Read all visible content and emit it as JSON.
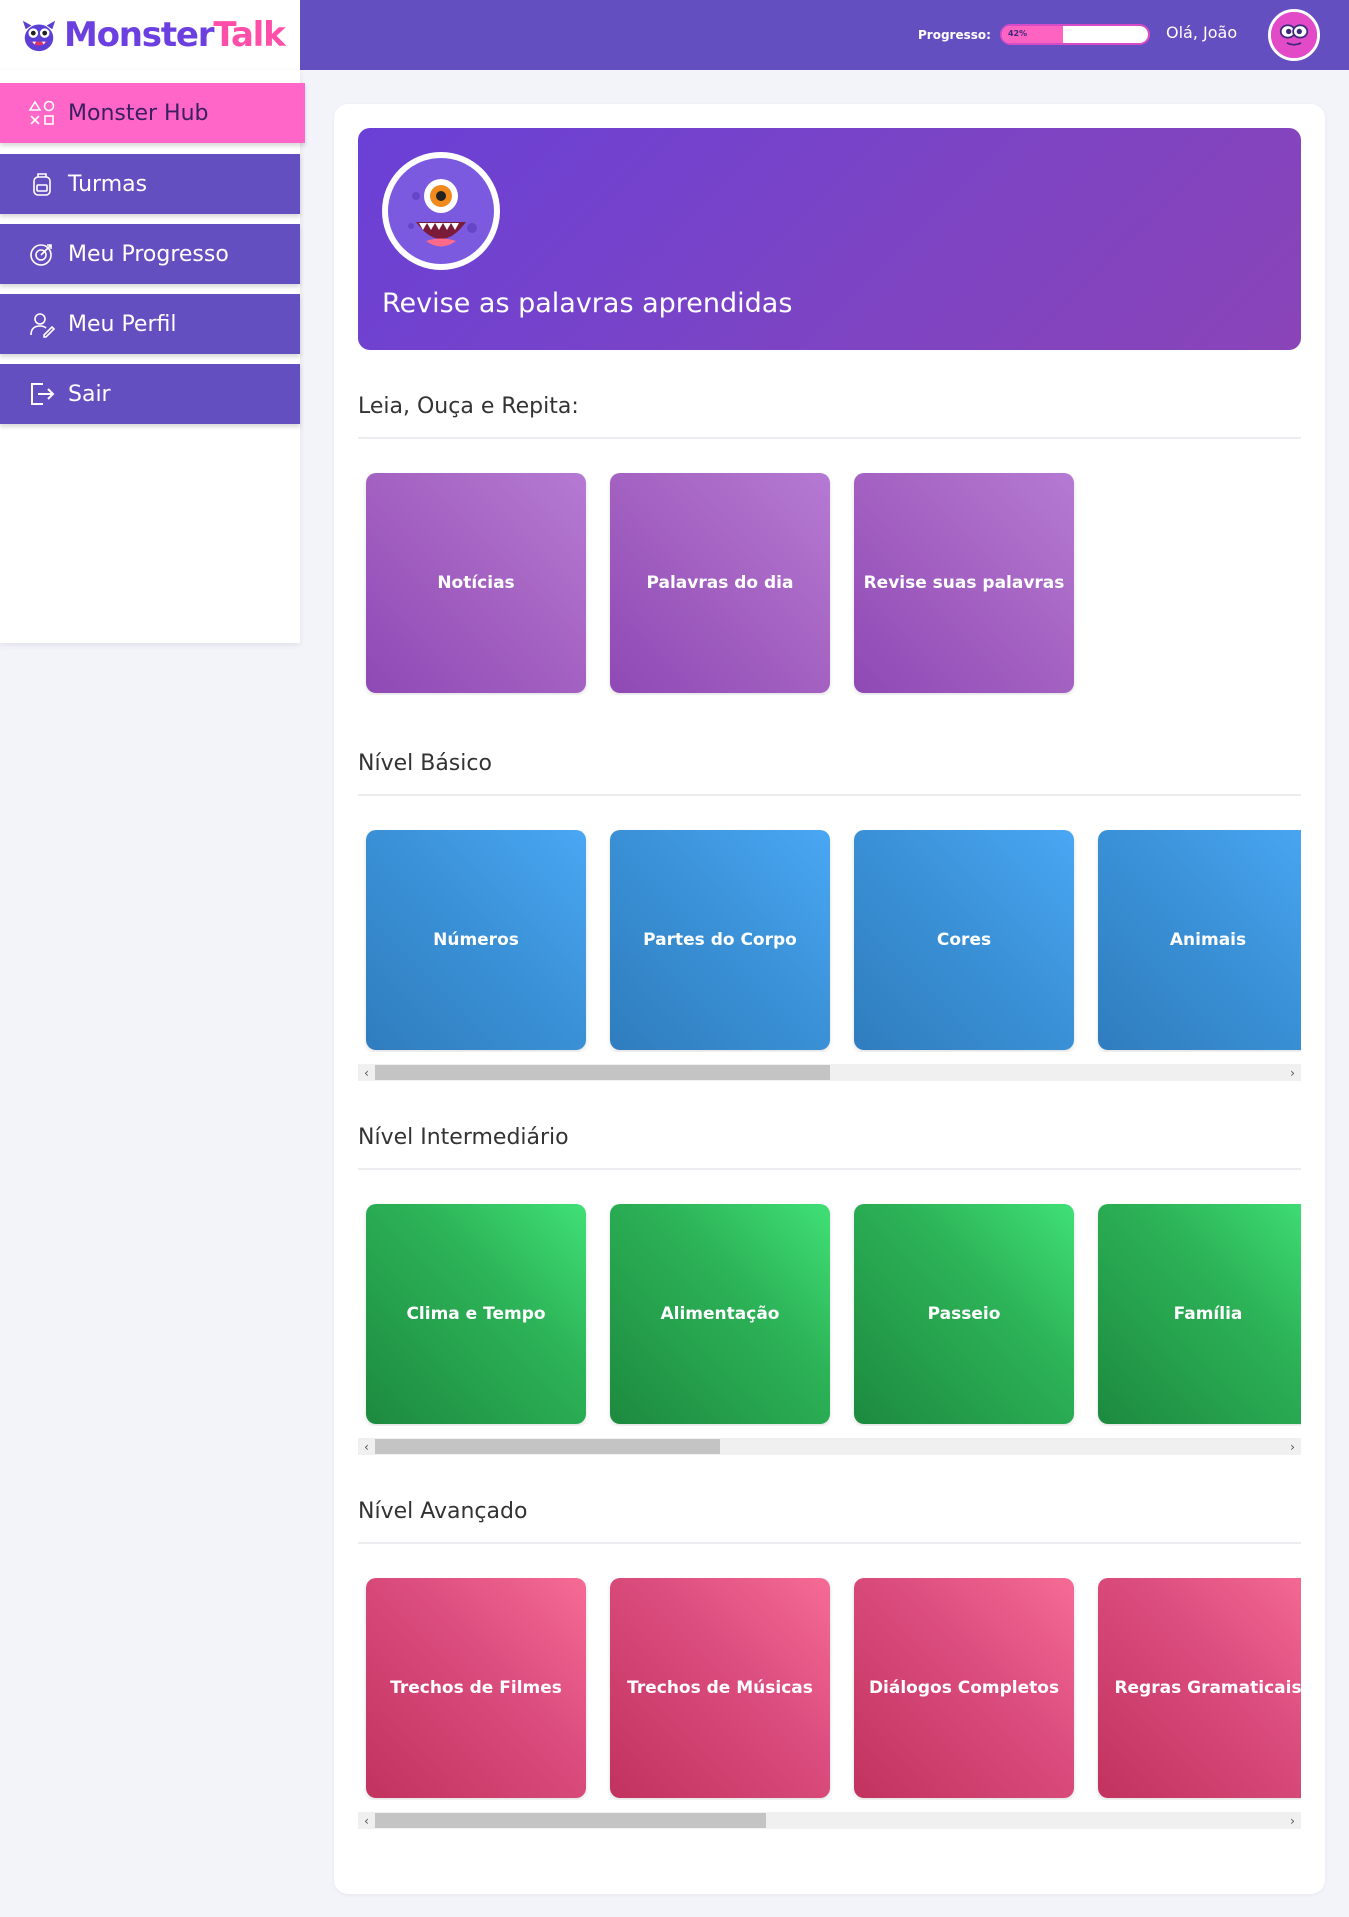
{
  "brand": {
    "part1": "Monster",
    "part2": "Talk"
  },
  "header": {
    "progress_label": "Progresso:",
    "progress_value": "42%",
    "progress_fraction": 0.42,
    "greeting": "Olá, João"
  },
  "sidebar": {
    "items": [
      {
        "label": "Monster Hub",
        "icon": "shapes-icon",
        "active": true
      },
      {
        "label": "Turmas",
        "icon": "backpack-icon",
        "active": false
      },
      {
        "label": "Meu Progresso",
        "icon": "progress-target-icon",
        "active": false
      },
      {
        "label": "Meu Perfil",
        "icon": "user-edit-icon",
        "active": false
      },
      {
        "label": "Sair",
        "icon": "logout-icon",
        "active": false
      }
    ]
  },
  "hero": {
    "title": "Revise as palavras aprendidas"
  },
  "sections": [
    {
      "title": "Leia, Ouça e Repita:",
      "color": "purple",
      "cards": [
        "Notícias",
        "Palavras do dia",
        "Revise suas palavras"
      ],
      "scroll_thumb_fraction": null
    },
    {
      "title": "Nível Básico",
      "color": "blue",
      "cards": [
        "Números",
        "Partes do Corpo",
        "Cores",
        "Animais"
      ],
      "scroll_thumb_fraction": 0.5
    },
    {
      "title": "Nível Intermediário",
      "color": "green",
      "cards": [
        "Clima e Tempo",
        "Alimentação",
        "Passeio",
        "Família"
      ],
      "scroll_thumb_fraction": 0.38
    },
    {
      "title": "Nível Avançado",
      "color": "pink",
      "cards": [
        "Trechos de Filmes",
        "Trechos de Músicas",
        "Diálogos Completos",
        "Regras Gramaticais"
      ],
      "scroll_thumb_fraction": 0.43
    }
  ],
  "colors": {
    "header": "#634fc0",
    "accent_pink": "#ff66c7",
    "brand_purple": "#6b3fe0"
  }
}
